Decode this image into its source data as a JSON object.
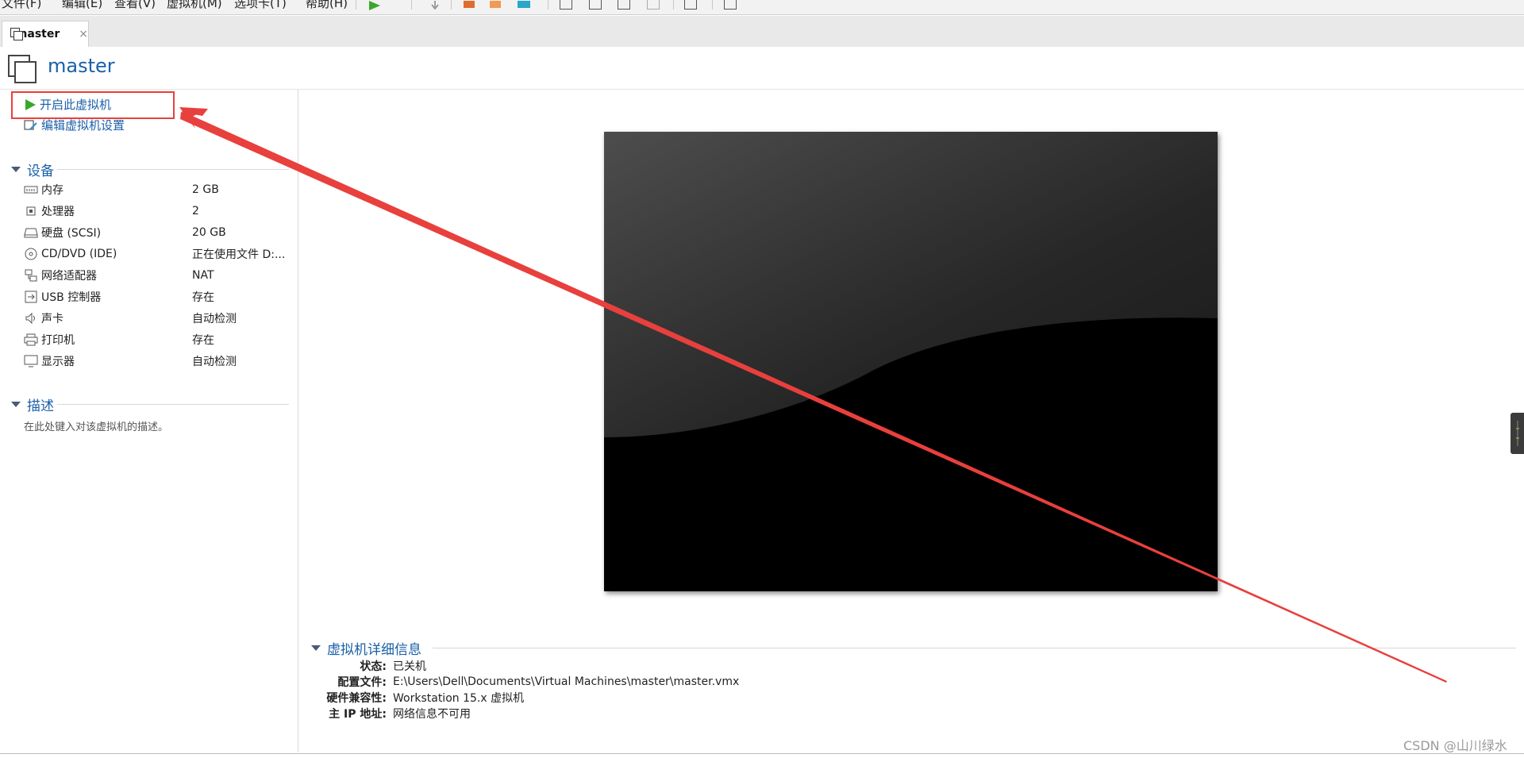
{
  "toolbar": {
    "menus": [
      "文件(F)",
      "编辑(E)",
      "查看(V)",
      "虚拟机(M)",
      "选项卡(T)",
      "帮助(H)"
    ]
  },
  "tab": {
    "label": "master",
    "close": "×"
  },
  "header": {
    "title": "master"
  },
  "actions": {
    "power_on": "开启此虚拟机",
    "edit_settings": "编辑虚拟机设置"
  },
  "devices": {
    "title": "设备",
    "items": [
      {
        "icon": "memory-icon",
        "name": "内存",
        "value": "2 GB"
      },
      {
        "icon": "processor-icon",
        "name": "处理器",
        "value": "2"
      },
      {
        "icon": "hard-disk-icon",
        "name": "硬盘 (SCSI)",
        "value": "20 GB"
      },
      {
        "icon": "cd-dvd-icon",
        "name": "CD/DVD (IDE)",
        "value": "正在使用文件 D:..."
      },
      {
        "icon": "network-adapter-icon",
        "name": "网络适配器",
        "value": "NAT"
      },
      {
        "icon": "usb-controller-icon",
        "name": "USB 控制器",
        "value": "存在"
      },
      {
        "icon": "sound-card-icon",
        "name": "声卡",
        "value": "自动检测"
      },
      {
        "icon": "printer-icon",
        "name": "打印机",
        "value": "存在"
      },
      {
        "icon": "display-icon",
        "name": "显示器",
        "value": "自动检测"
      }
    ]
  },
  "description": {
    "title": "描述",
    "placeholder": "在此处键入对该虚拟机的描述。"
  },
  "details": {
    "title": "虚拟机详细信息",
    "rows": [
      {
        "label": "状态:",
        "value": "已关机"
      },
      {
        "label": "配置文件:",
        "value": "E:\\Users\\Dell\\Documents\\Virtual Machines\\master\\master.vmx"
      },
      {
        "label": "硬件兼容性:",
        "value": "Workstation 15.x 虚拟机"
      },
      {
        "label": "主 IP 地址:",
        "value": "网络信息不可用"
      }
    ]
  },
  "watermark": "CSDN @山川绿水",
  "colors": {
    "link": "#1a5fa8",
    "annotation": "#e8403d",
    "play": "#3aa72b"
  }
}
